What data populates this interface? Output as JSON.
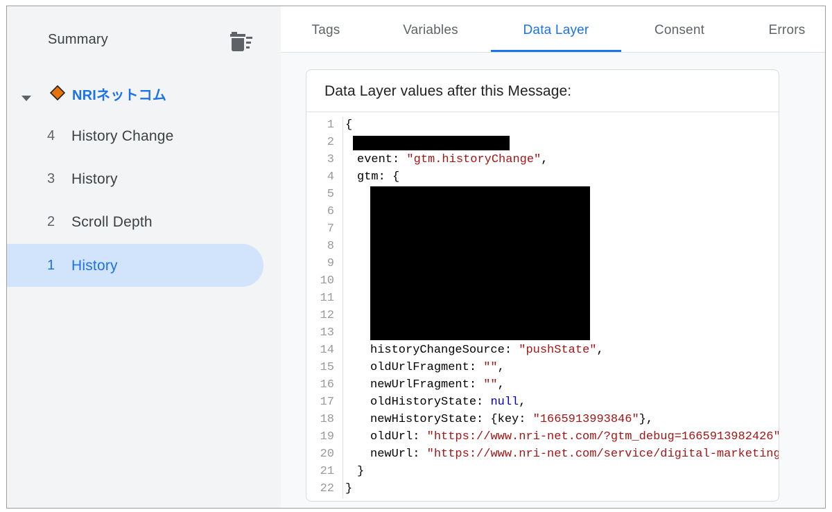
{
  "sidebar": {
    "summary_label": "Summary",
    "container_name": "NRIネットコム",
    "events": [
      {
        "num": "4",
        "label": "History Change",
        "selected": false
      },
      {
        "num": "3",
        "label": "History",
        "selected": false
      },
      {
        "num": "2",
        "label": "Scroll Depth",
        "selected": false
      },
      {
        "num": "1",
        "label": "History",
        "selected": true
      }
    ],
    "icons": {
      "delete": "delete-sweep-icon",
      "expand": "caret-down-icon",
      "container": "tag-diamond-icon"
    },
    "container_icon_color": "#e8710a"
  },
  "tabs": [
    {
      "label": "Tags",
      "active": false
    },
    {
      "label": "Variables",
      "active": false
    },
    {
      "label": "Data Layer",
      "active": true
    },
    {
      "label": "Consent",
      "active": false
    },
    {
      "label": "Errors",
      "active": false
    }
  ],
  "card": {
    "title": "Data Layer values after this Message:"
  },
  "code": {
    "line_numbers": [
      "1",
      "2",
      "3",
      "4",
      "5",
      "6",
      "7",
      "8",
      "9",
      "10",
      "11",
      "12",
      "13",
      "14",
      "15",
      "16",
      "17",
      "18",
      "19",
      "20",
      "21",
      "22"
    ],
    "lines": {
      "l1": "{",
      "l3_key": "event: ",
      "l3_val": "\"gtm.historyChange\"",
      "l3_tail": ",",
      "l4": "gtm: {",
      "l14_key": "historyChangeSource: ",
      "l14_val": "\"pushState\"",
      "l14_tail": ",",
      "l15_key": "oldUrlFragment: ",
      "l15_val": "\"\"",
      "l15_tail": ",",
      "l16_key": "newUrlFragment: ",
      "l16_val": "\"\"",
      "l16_tail": ",",
      "l17_key": "oldHistoryState: ",
      "l17_val": "null",
      "l17_tail": ",",
      "l18_key": "newHistoryState: {key: ",
      "l18_val": "\"1665913993846\"",
      "l18_tail": "},",
      "l19_key": "oldUrl: ",
      "l19_val": "\"https://www.nri-net.com/?gtm_debug=1665913982426\"",
      "l19_tail": ",",
      "l20_key": "newUrl: ",
      "l20_val": "\"https://www.nri-net.com/service/digital-marketing/\"",
      "l21": "}",
      "l22": "}"
    }
  },
  "colors": {
    "accent": "#1a73e8",
    "selected_bg": "#d2e3fc",
    "string": "#a31515",
    "keyword": "#0000b8",
    "redaction": "#000000"
  }
}
